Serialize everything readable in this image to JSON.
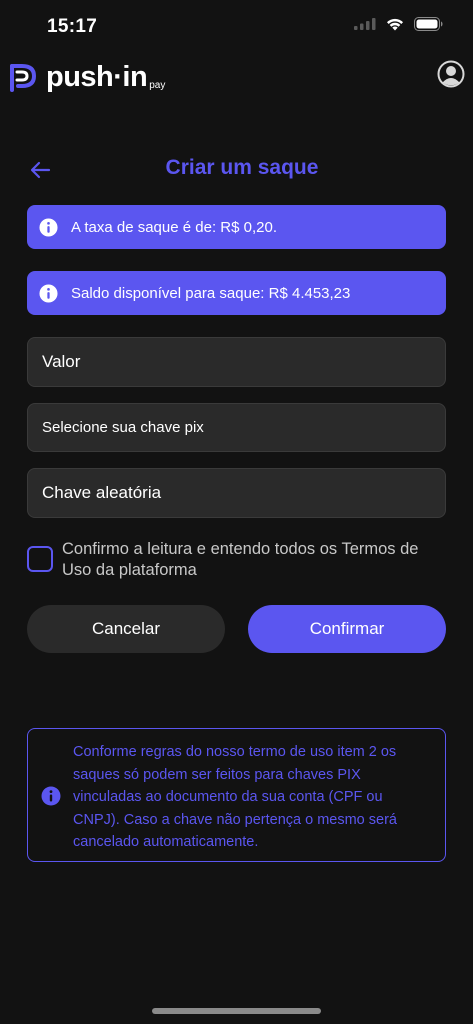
{
  "status_bar": {
    "time": "15:17"
  },
  "header": {
    "logo_text": "push·in",
    "logo_sub": "pay"
  },
  "page": {
    "title": "Criar um saque"
  },
  "banners": {
    "fee": "A taxa de saque é de: R$ 0,20.",
    "balance": "Saldo disponível para saque: R$ 4.453,23"
  },
  "form": {
    "amount_placeholder": "Valor",
    "pix_key_select": "Selecione sua chave pix",
    "pix_key_value": "Chave aleatória",
    "terms_label": "Confirmo a leitura e entendo todos os Termos de Uso da plataforma",
    "terms_checked": false
  },
  "buttons": {
    "cancel": "Cancelar",
    "confirm": "Confirmar"
  },
  "notice": {
    "text": "Conforme regras do nosso termo de uso item 2 os saques só podem ser feitos para chaves PIX vinculadas ao documento da sua conta (CPF ou CNPJ). Caso a chave não pertença o mesmo será cancelado automaticamente."
  },
  "colors": {
    "accent": "#5b56f0",
    "background": "#121212",
    "field_bg": "#2a2a2a"
  },
  "icons": {
    "status": [
      "signal-icon",
      "wifi-icon",
      "battery-icon"
    ],
    "header": [
      "logo-icon",
      "profile-icon"
    ],
    "nav": "back-arrow-icon",
    "info": "info-icon"
  }
}
